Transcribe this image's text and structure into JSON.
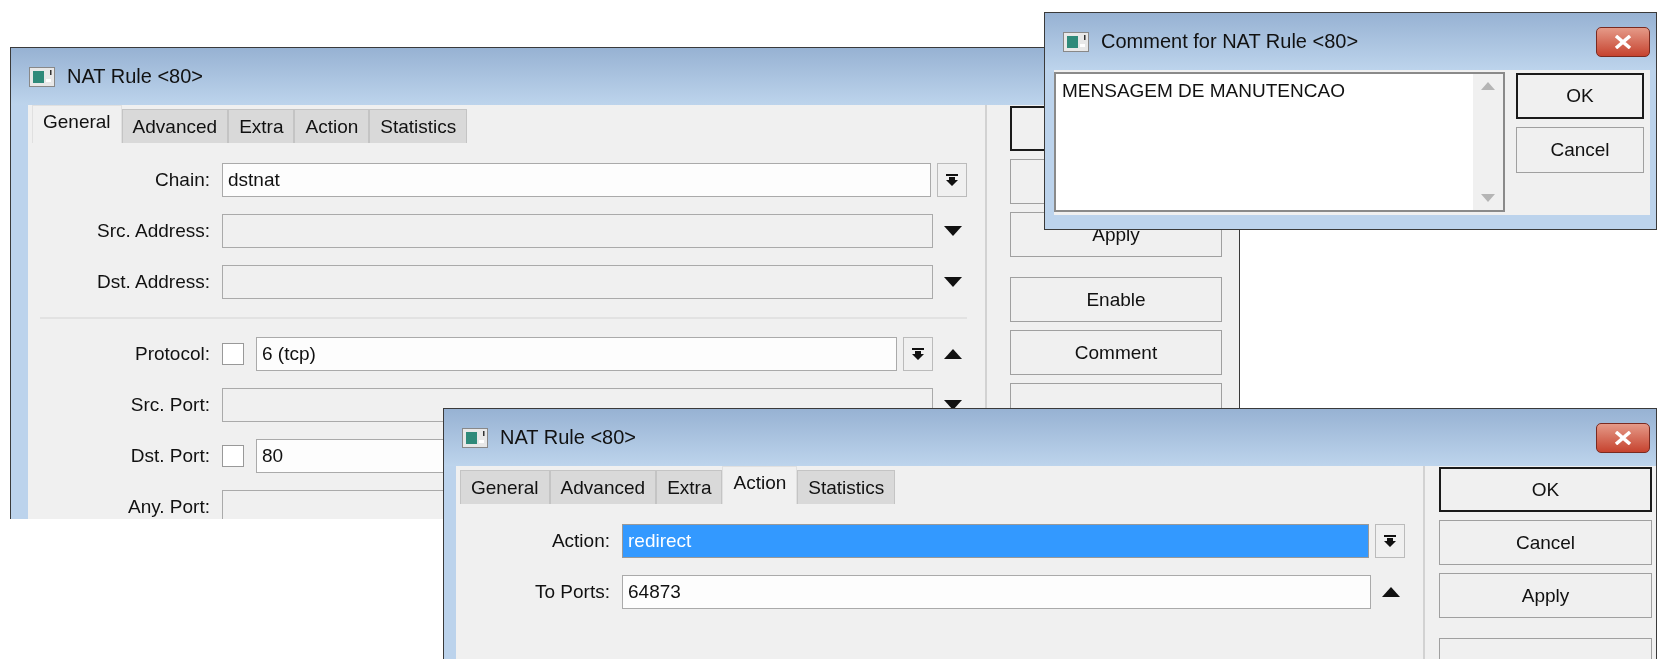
{
  "windows": [
    {
      "kind": "rule",
      "title": "NAT Rule <80>",
      "tabs": [
        {
          "label": "General",
          "selected": true
        },
        {
          "label": "Advanced",
          "selected": false
        },
        {
          "label": "Extra",
          "selected": false
        },
        {
          "label": "Action",
          "selected": false
        },
        {
          "label": "Statistics",
          "selected": false
        }
      ],
      "fields": [
        {
          "kind": "field",
          "label": "Chain:",
          "value": "dstnat",
          "editable": true,
          "combo_button": true
        },
        {
          "kind": "field",
          "label": "Src. Address:",
          "editable": false,
          "arrow_down": true
        },
        {
          "kind": "field",
          "label": "Dst. Address:",
          "editable": false,
          "arrow_down": true
        },
        {
          "kind": "separator"
        },
        {
          "kind": "field",
          "label": "Protocol:",
          "checked": false,
          "value": "6 (tcp)",
          "editable": true,
          "combo_button": true,
          "arrow_up": true
        },
        {
          "kind": "field",
          "label": "Src. Port:",
          "editable": false,
          "arrow_down": true
        },
        {
          "kind": "field",
          "label": "Dst. Port:",
          "checked": false,
          "value": "80",
          "editable": true
        },
        {
          "kind": "field",
          "label": "Any. Port:",
          "editable": false
        }
      ],
      "buttons": [
        {
          "default": true
        },
        {
          "default": false
        },
        {
          "label": "Apply"
        },
        {
          "label": "Enable"
        },
        {
          "label": "Comment"
        },
        {
          "default": false
        }
      ]
    },
    {
      "kind": "comment",
      "title": "Comment for NAT Rule <80>",
      "close_button": true,
      "text": "MENSAGEM DE MANUTENCAO",
      "buttons": [
        {
          "label": "OK",
          "default": true
        },
        {
          "label": "Cancel",
          "default": false
        }
      ]
    },
    {
      "kind": "rule",
      "title": "NAT Rule <80>",
      "close_button": true,
      "tabs": [
        {
          "label": "General",
          "selected": false
        },
        {
          "label": "Advanced",
          "selected": false
        },
        {
          "label": "Extra",
          "selected": false
        },
        {
          "label": "Action",
          "selected": true
        },
        {
          "label": "Statistics",
          "selected": false
        }
      ],
      "fields": [
        {
          "kind": "field",
          "label": "Action:",
          "value": "redirect",
          "editable": true,
          "highlighted": true,
          "combo_button": true
        },
        {
          "kind": "field",
          "label": "To Ports:",
          "value": "64873",
          "editable": true,
          "arrow_up": true
        }
      ],
      "buttons": [
        {
          "label": "OK",
          "default": true
        },
        {
          "label": "Cancel",
          "default": false
        },
        {
          "label": "Apply",
          "default": false
        },
        {
          "default": false
        }
      ]
    }
  ]
}
